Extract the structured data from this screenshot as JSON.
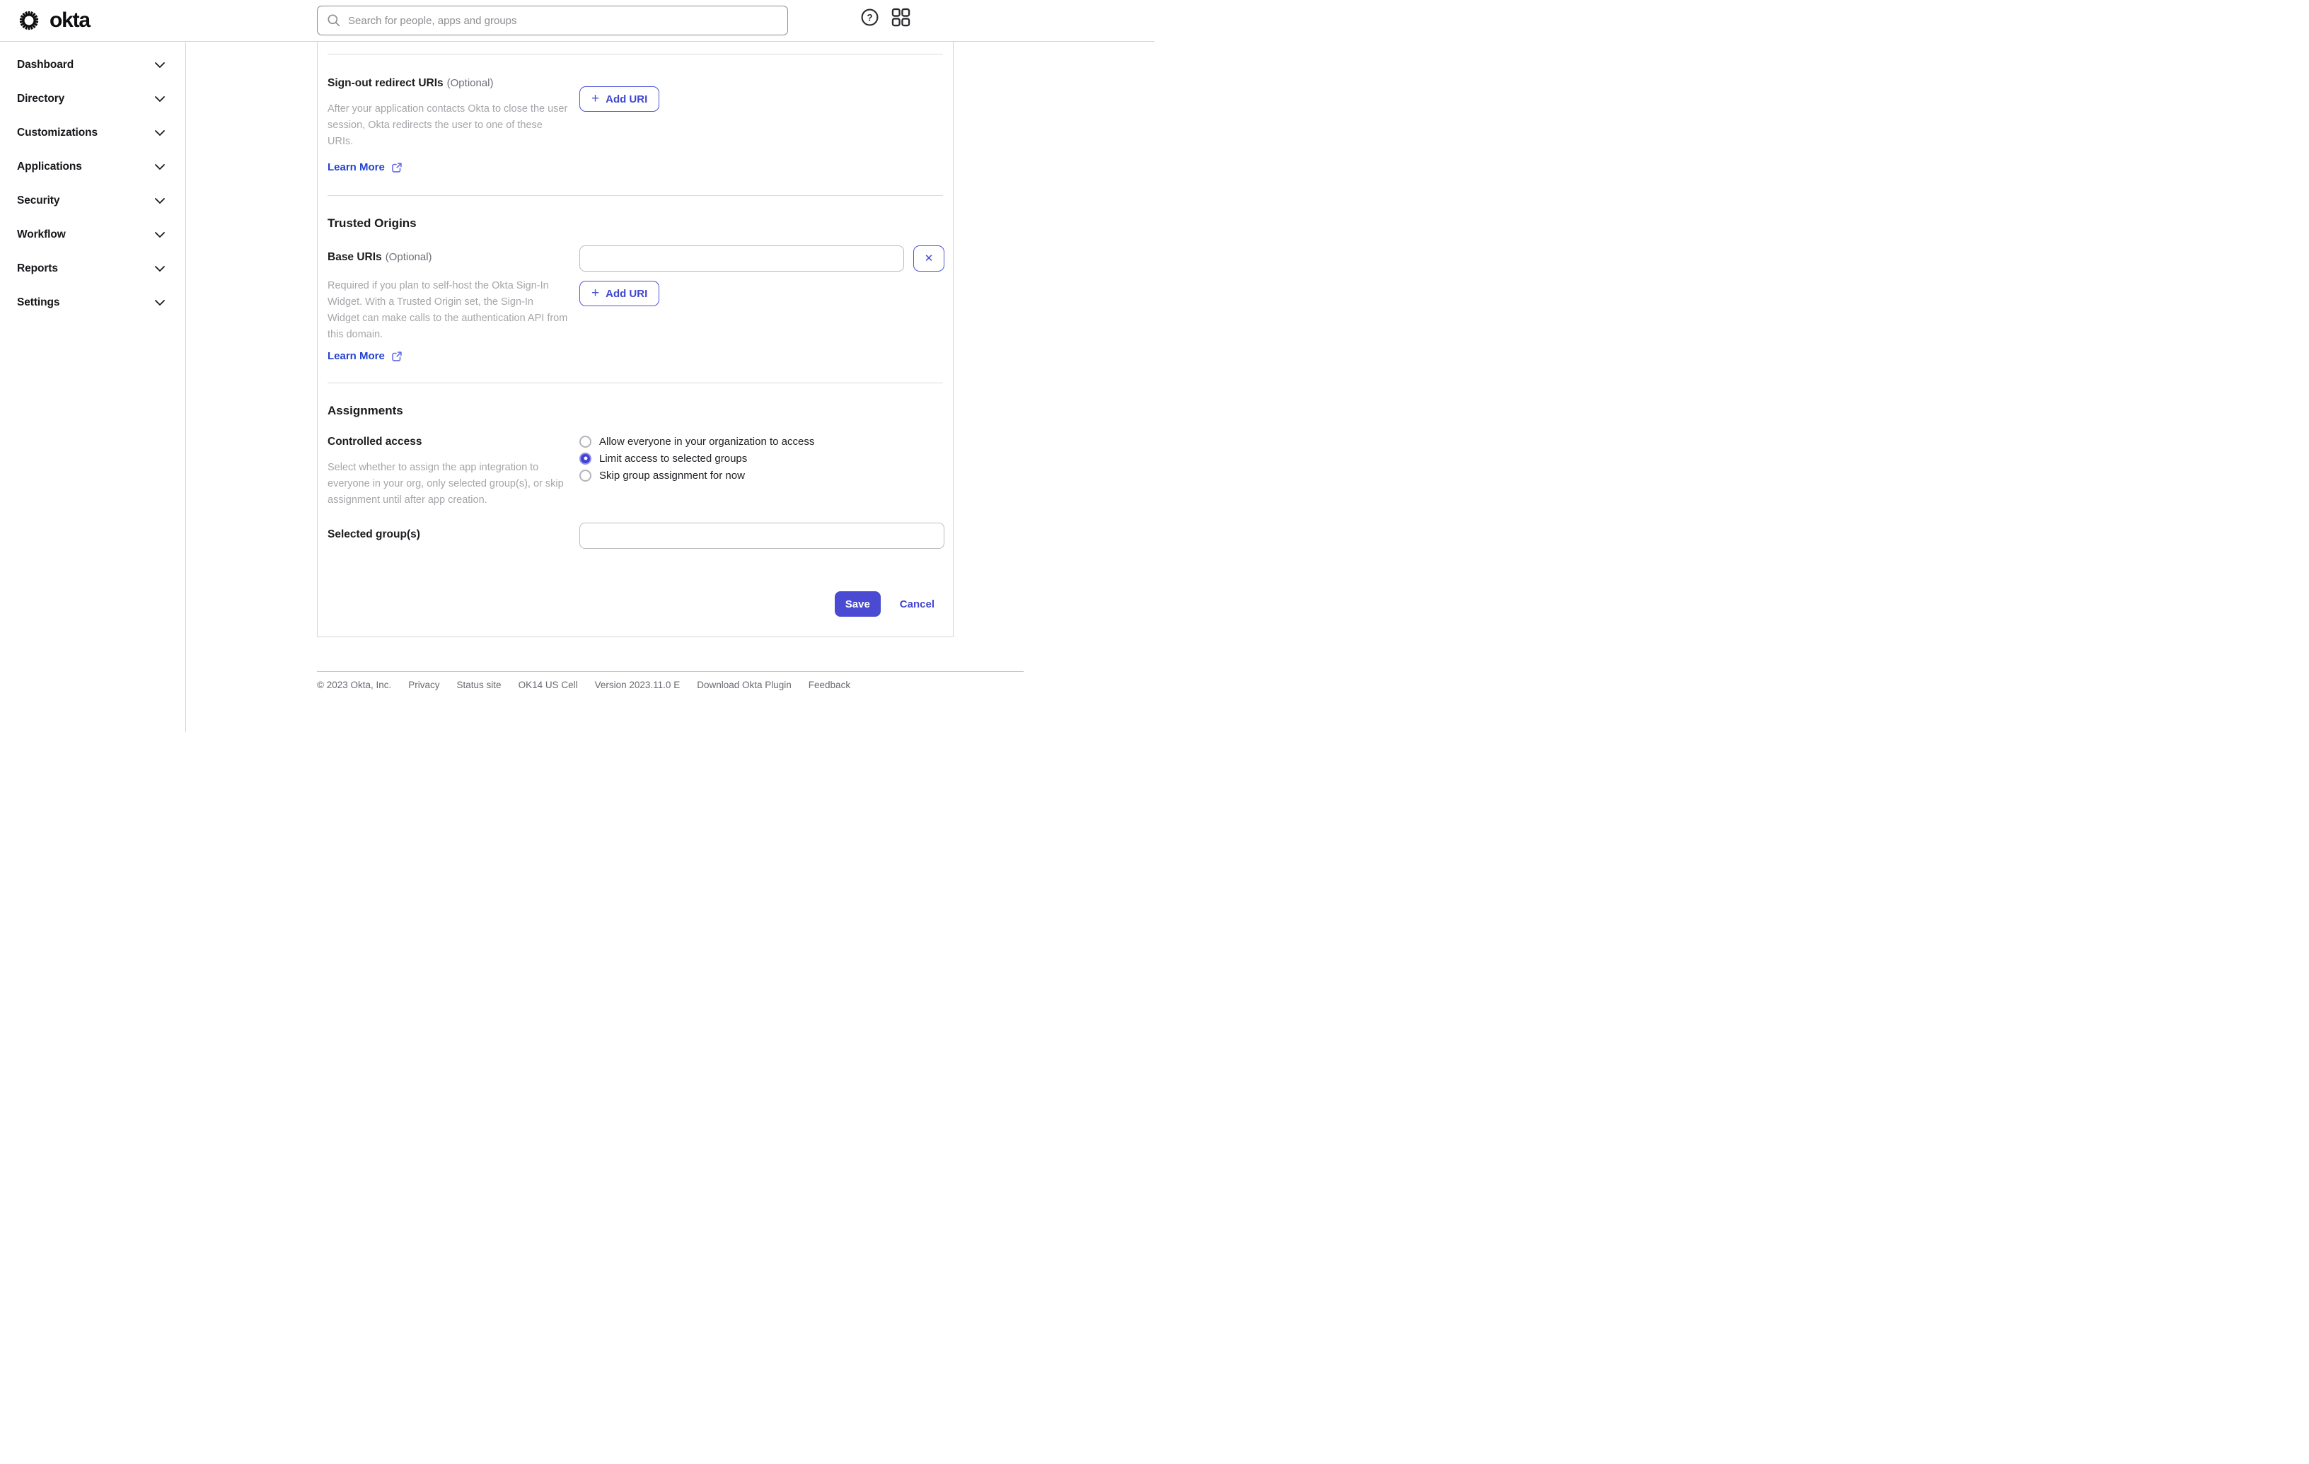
{
  "header": {
    "logo_text": "okta",
    "search": {
      "placeholder": "Search for people, apps and groups",
      "value": ""
    }
  },
  "icons": {
    "plus": "+",
    "close": "✕",
    "help_glyph": "?"
  },
  "sidebar": {
    "items": [
      {
        "label": "Dashboard"
      },
      {
        "label": "Directory"
      },
      {
        "label": "Customizations"
      },
      {
        "label": "Applications"
      },
      {
        "label": "Security"
      },
      {
        "label": "Workflow"
      },
      {
        "label": "Reports"
      },
      {
        "label": "Settings"
      }
    ]
  },
  "main": {
    "signout": {
      "label": "Sign-out redirect URIs",
      "optional": "(Optional)",
      "description": "After your application contacts Okta to close the user session, Okta redirects the user to one of these URIs.",
      "learn_more": "Learn More",
      "add_uri_label": "Add URI"
    },
    "trusted": {
      "heading": "Trusted Origins",
      "base_label": "Base URIs",
      "optional": "(Optional)",
      "description": "Required if you plan to self-host the Okta Sign-In Widget. With a Trusted Origin set, the Sign-In Widget can make calls to the authentication API from this domain.",
      "learn_more": "Learn More",
      "add_uri_label": "Add URI",
      "base_uri_value": ""
    },
    "assignments": {
      "heading": "Assignments",
      "controlled_label": "Controlled access",
      "description": "Select whether to assign the app integration to everyone in your org, only selected group(s), or skip assignment until after app creation.",
      "options": [
        {
          "label": "Allow everyone in your organization to access",
          "selected": false
        },
        {
          "label": "Limit access to selected groups",
          "selected": true
        },
        {
          "label": "Skip group assignment for now",
          "selected": false
        }
      ],
      "groups_label": "Selected group(s)",
      "groups_value": ""
    },
    "actions": {
      "save_label": "Save",
      "cancel_label": "Cancel"
    }
  },
  "footer": {
    "items": [
      "© 2023 Okta, Inc.",
      "Privacy",
      "Status site",
      "OK14 US Cell",
      "Version 2023.11.0 E",
      "Download Okta Plugin",
      "Feedback"
    ]
  },
  "colors": {
    "accent_indigo": "#4a4bd2",
    "link_blue": "#2443d2",
    "radio_selected_fill": "#4140d2",
    "radio_selected_ring": "#8c8ef2",
    "divider_gray": "#d2d2d6",
    "desc_gray": "#a6a6ab"
  }
}
